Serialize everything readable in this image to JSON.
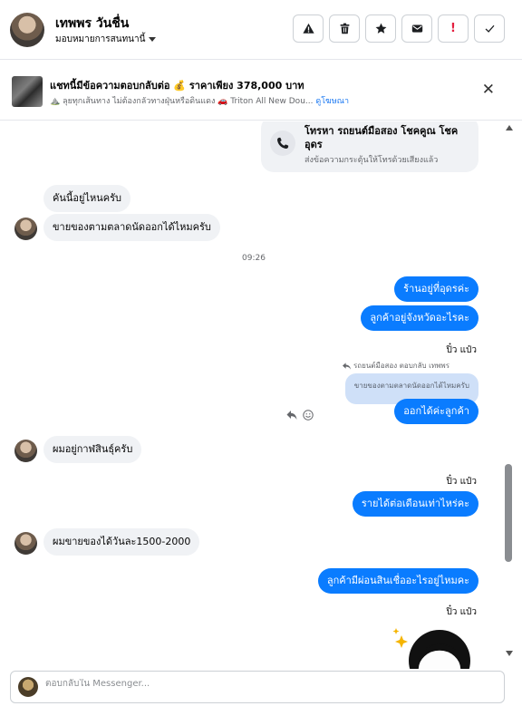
{
  "header": {
    "contact_name": "เทพพร วันชื่น",
    "assign_label": "มอบหมายการสนทนานี้",
    "actions": [
      {
        "icon": "alert-triangle-icon",
        "label": ""
      },
      {
        "icon": "trash-icon",
        "label": ""
      },
      {
        "icon": "star-icon",
        "label": ""
      },
      {
        "icon": "mail-icon",
        "label": ""
      },
      {
        "icon": "spam-icon",
        "label": ""
      },
      {
        "icon": "check-icon",
        "label": ""
      }
    ]
  },
  "banner": {
    "title": "แชทนี้มีข้อความตอบกลับต่อ 💰 ราคาเพียง 378,000 บาท",
    "subtitle": "⛰️ ลุยทุกเส้นทาง ไม่ต้องกลัวทางฝุ่นหรือดินแดง 🚗 Triton All New Dou...",
    "link": "ดูโฆษณา"
  },
  "call_card": {
    "title": "โทรหา รถยนต์มือสอง โชคคูณ โชค อุดร",
    "subtitle": "ส่งข้อความกระตุ้นให้โทรด้วยเสียงแล้ว"
  },
  "messages": {
    "in1": "คันนี้อยู่ไหนครับ",
    "in2": "ขายของตามตลาดนัดออกได้ไหมครับ",
    "time1": "09:26",
    "out1": "ร้านอยู่ที่อุดรค่ะ",
    "out2": "ลูกค้าอยู่จังหวัดอะไรคะ",
    "sender1": "ปิ๋ว แป๋ว",
    "reply_note": "รถยนต์มือสอง ตอบกลับ เทพพร",
    "quoted": "ขายของตามตลาดนัดออกได้ไหมครับ",
    "out3": "ออกได้ค่ะลูกค้า",
    "in3": "ผมอยู่กาฬสินธุ์ครับ",
    "sender2": "ปิ๋ว แป๋ว",
    "out4": "รายได้ต่อเดือนเท่าไหร่คะ",
    "in4": "ผมขายของได้วันละ1500-2000",
    "out5": "ลูกค้ามีผ่อนสินเชื่ออะไรอยู่ไหมคะ",
    "sender3": "ปิ๋ว แป๋ว"
  },
  "composer": {
    "placeholder": "ตอบกลับใน Messenger..."
  },
  "colors": {
    "outgoing_bubble": "#0a7cff",
    "incoming_bubble": "#f0f2f5",
    "link": "#1877f2"
  }
}
